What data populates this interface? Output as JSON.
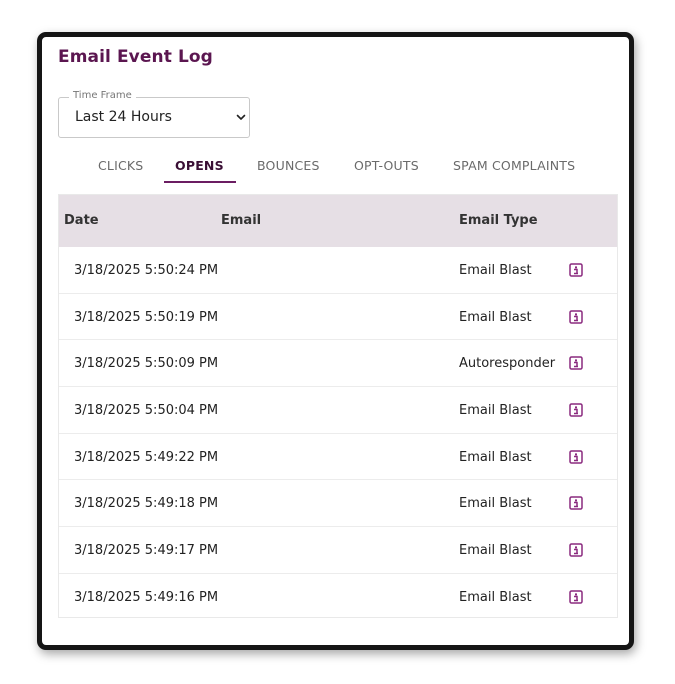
{
  "title": "Email Event Log",
  "time_frame": {
    "label": "Time Frame",
    "value": "Last 24 Hours"
  },
  "tabs": [
    {
      "label": "CLICKS",
      "active": false
    },
    {
      "label": "OPENS",
      "active": true
    },
    {
      "label": "BOUNCES",
      "active": false
    },
    {
      "label": "OPT-OUTS",
      "active": false
    },
    {
      "label": "SPAM COMPLAINTS",
      "active": false
    }
  ],
  "table": {
    "headers": {
      "date": "Date",
      "email": "Email",
      "email_type": "Email Type"
    },
    "rows": [
      {
        "date": "3/18/2025 5:50:24 PM",
        "email": "",
        "email_type": "Email Blast"
      },
      {
        "date": "3/18/2025 5:50:19 PM",
        "email": "",
        "email_type": "Email Blast"
      },
      {
        "date": "3/18/2025 5:50:09 PM",
        "email": "",
        "email_type": "Autoresponder"
      },
      {
        "date": "3/18/2025 5:50:04 PM",
        "email": "",
        "email_type": "Email Blast"
      },
      {
        "date": "3/18/2025 5:49:22 PM",
        "email": "",
        "email_type": "Email Blast"
      },
      {
        "date": "3/18/2025 5:49:18 PM",
        "email": "",
        "email_type": "Email Blast"
      },
      {
        "date": "3/18/2025 5:49:17 PM",
        "email": "",
        "email_type": "Email Blast"
      },
      {
        "date": "3/18/2025 5:49:16 PM",
        "email": "",
        "email_type": "Email Blast"
      }
    ]
  },
  "icons": {
    "row_action": "info-icon",
    "dropdown": "chevron-down-icon"
  },
  "colors": {
    "accent": "#5b1650",
    "tab_underline": "#6b1d62",
    "header_bg": "#e6dfe5",
    "info_icon": "#8a2a7f"
  }
}
